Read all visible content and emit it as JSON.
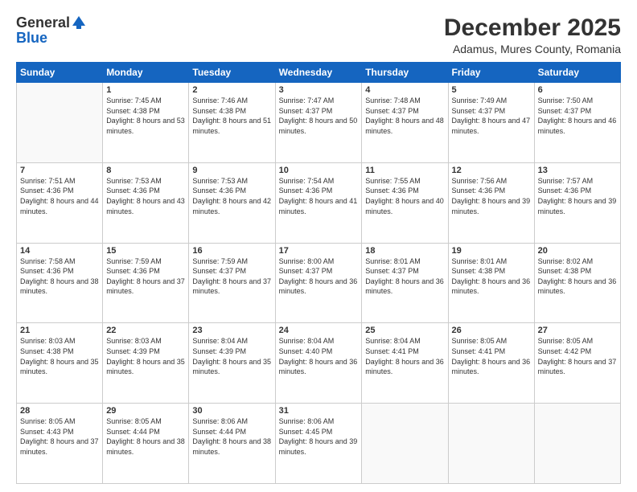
{
  "header": {
    "logo_general": "General",
    "logo_blue": "Blue",
    "month_year": "December 2025",
    "location": "Adamus, Mures County, Romania"
  },
  "days_of_week": [
    "Sunday",
    "Monday",
    "Tuesday",
    "Wednesday",
    "Thursday",
    "Friday",
    "Saturday"
  ],
  "weeks": [
    [
      {
        "day": "",
        "sunrise": "",
        "sunset": "",
        "daylight": ""
      },
      {
        "day": "1",
        "sunrise": "Sunrise: 7:45 AM",
        "sunset": "Sunset: 4:38 PM",
        "daylight": "Daylight: 8 hours and 53 minutes."
      },
      {
        "day": "2",
        "sunrise": "Sunrise: 7:46 AM",
        "sunset": "Sunset: 4:38 PM",
        "daylight": "Daylight: 8 hours and 51 minutes."
      },
      {
        "day": "3",
        "sunrise": "Sunrise: 7:47 AM",
        "sunset": "Sunset: 4:37 PM",
        "daylight": "Daylight: 8 hours and 50 minutes."
      },
      {
        "day": "4",
        "sunrise": "Sunrise: 7:48 AM",
        "sunset": "Sunset: 4:37 PM",
        "daylight": "Daylight: 8 hours and 48 minutes."
      },
      {
        "day": "5",
        "sunrise": "Sunrise: 7:49 AM",
        "sunset": "Sunset: 4:37 PM",
        "daylight": "Daylight: 8 hours and 47 minutes."
      },
      {
        "day": "6",
        "sunrise": "Sunrise: 7:50 AM",
        "sunset": "Sunset: 4:37 PM",
        "daylight": "Daylight: 8 hours and 46 minutes."
      }
    ],
    [
      {
        "day": "7",
        "sunrise": "Sunrise: 7:51 AM",
        "sunset": "Sunset: 4:36 PM",
        "daylight": "Daylight: 8 hours and 44 minutes."
      },
      {
        "day": "8",
        "sunrise": "Sunrise: 7:53 AM",
        "sunset": "Sunset: 4:36 PM",
        "daylight": "Daylight: 8 hours and 43 minutes."
      },
      {
        "day": "9",
        "sunrise": "Sunrise: 7:53 AM",
        "sunset": "Sunset: 4:36 PM",
        "daylight": "Daylight: 8 hours and 42 minutes."
      },
      {
        "day": "10",
        "sunrise": "Sunrise: 7:54 AM",
        "sunset": "Sunset: 4:36 PM",
        "daylight": "Daylight: 8 hours and 41 minutes."
      },
      {
        "day": "11",
        "sunrise": "Sunrise: 7:55 AM",
        "sunset": "Sunset: 4:36 PM",
        "daylight": "Daylight: 8 hours and 40 minutes."
      },
      {
        "day": "12",
        "sunrise": "Sunrise: 7:56 AM",
        "sunset": "Sunset: 4:36 PM",
        "daylight": "Daylight: 8 hours and 39 minutes."
      },
      {
        "day": "13",
        "sunrise": "Sunrise: 7:57 AM",
        "sunset": "Sunset: 4:36 PM",
        "daylight": "Daylight: 8 hours and 39 minutes."
      }
    ],
    [
      {
        "day": "14",
        "sunrise": "Sunrise: 7:58 AM",
        "sunset": "Sunset: 4:36 PM",
        "daylight": "Daylight: 8 hours and 38 minutes."
      },
      {
        "day": "15",
        "sunrise": "Sunrise: 7:59 AM",
        "sunset": "Sunset: 4:36 PM",
        "daylight": "Daylight: 8 hours and 37 minutes."
      },
      {
        "day": "16",
        "sunrise": "Sunrise: 7:59 AM",
        "sunset": "Sunset: 4:37 PM",
        "daylight": "Daylight: 8 hours and 37 minutes."
      },
      {
        "day": "17",
        "sunrise": "Sunrise: 8:00 AM",
        "sunset": "Sunset: 4:37 PM",
        "daylight": "Daylight: 8 hours and 36 minutes."
      },
      {
        "day": "18",
        "sunrise": "Sunrise: 8:01 AM",
        "sunset": "Sunset: 4:37 PM",
        "daylight": "Daylight: 8 hours and 36 minutes."
      },
      {
        "day": "19",
        "sunrise": "Sunrise: 8:01 AM",
        "sunset": "Sunset: 4:38 PM",
        "daylight": "Daylight: 8 hours and 36 minutes."
      },
      {
        "day": "20",
        "sunrise": "Sunrise: 8:02 AM",
        "sunset": "Sunset: 4:38 PM",
        "daylight": "Daylight: 8 hours and 36 minutes."
      }
    ],
    [
      {
        "day": "21",
        "sunrise": "Sunrise: 8:03 AM",
        "sunset": "Sunset: 4:38 PM",
        "daylight": "Daylight: 8 hours and 35 minutes."
      },
      {
        "day": "22",
        "sunrise": "Sunrise: 8:03 AM",
        "sunset": "Sunset: 4:39 PM",
        "daylight": "Daylight: 8 hours and 35 minutes."
      },
      {
        "day": "23",
        "sunrise": "Sunrise: 8:04 AM",
        "sunset": "Sunset: 4:39 PM",
        "daylight": "Daylight: 8 hours and 35 minutes."
      },
      {
        "day": "24",
        "sunrise": "Sunrise: 8:04 AM",
        "sunset": "Sunset: 4:40 PM",
        "daylight": "Daylight: 8 hours and 36 minutes."
      },
      {
        "day": "25",
        "sunrise": "Sunrise: 8:04 AM",
        "sunset": "Sunset: 4:41 PM",
        "daylight": "Daylight: 8 hours and 36 minutes."
      },
      {
        "day": "26",
        "sunrise": "Sunrise: 8:05 AM",
        "sunset": "Sunset: 4:41 PM",
        "daylight": "Daylight: 8 hours and 36 minutes."
      },
      {
        "day": "27",
        "sunrise": "Sunrise: 8:05 AM",
        "sunset": "Sunset: 4:42 PM",
        "daylight": "Daylight: 8 hours and 37 minutes."
      }
    ],
    [
      {
        "day": "28",
        "sunrise": "Sunrise: 8:05 AM",
        "sunset": "Sunset: 4:43 PM",
        "daylight": "Daylight: 8 hours and 37 minutes."
      },
      {
        "day": "29",
        "sunrise": "Sunrise: 8:05 AM",
        "sunset": "Sunset: 4:44 PM",
        "daylight": "Daylight: 8 hours and 38 minutes."
      },
      {
        "day": "30",
        "sunrise": "Sunrise: 8:06 AM",
        "sunset": "Sunset: 4:44 PM",
        "daylight": "Daylight: 8 hours and 38 minutes."
      },
      {
        "day": "31",
        "sunrise": "Sunrise: 8:06 AM",
        "sunset": "Sunset: 4:45 PM",
        "daylight": "Daylight: 8 hours and 39 minutes."
      },
      {
        "day": "",
        "sunrise": "",
        "sunset": "",
        "daylight": ""
      },
      {
        "day": "",
        "sunrise": "",
        "sunset": "",
        "daylight": ""
      },
      {
        "day": "",
        "sunrise": "",
        "sunset": "",
        "daylight": ""
      }
    ]
  ]
}
